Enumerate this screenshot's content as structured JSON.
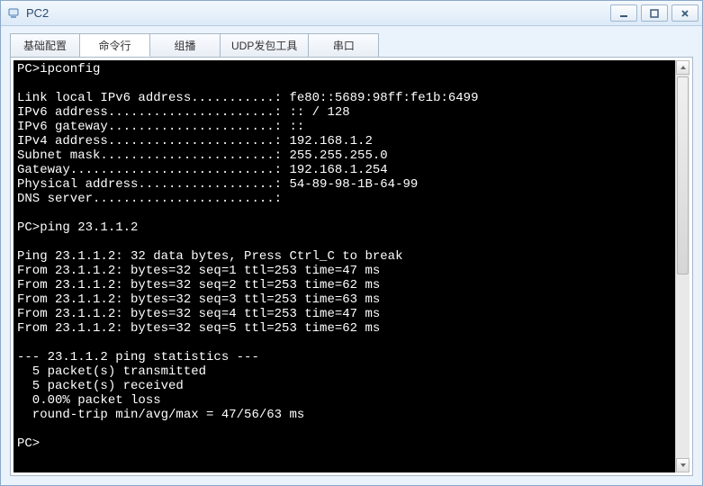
{
  "window": {
    "title": "PC2"
  },
  "tabs": [
    {
      "label": "基础配置"
    },
    {
      "label": "命令行"
    },
    {
      "label": "组播"
    },
    {
      "label": "UDP发包工具"
    },
    {
      "label": "串口"
    }
  ],
  "terminal": {
    "lines": [
      "PC>ipconfig",
      "",
      "Link local IPv6 address...........: fe80::5689:98ff:fe1b:6499",
      "IPv6 address......................: :: / 128",
      "IPv6 gateway......................: ::",
      "IPv4 address......................: 192.168.1.2",
      "Subnet mask.......................: 255.255.255.0",
      "Gateway...........................: 192.168.1.254",
      "Physical address..................: 54-89-98-1B-64-99",
      "DNS server........................:",
      "",
      "PC>ping 23.1.1.2",
      "",
      "Ping 23.1.1.2: 32 data bytes, Press Ctrl_C to break",
      "From 23.1.1.2: bytes=32 seq=1 ttl=253 time=47 ms",
      "From 23.1.1.2: bytes=32 seq=2 ttl=253 time=62 ms",
      "From 23.1.1.2: bytes=32 seq=3 ttl=253 time=63 ms",
      "From 23.1.1.2: bytes=32 seq=4 ttl=253 time=47 ms",
      "From 23.1.1.2: bytes=32 seq=5 ttl=253 time=62 ms",
      "",
      "--- 23.1.1.2 ping statistics ---",
      "  5 packet(s) transmitted",
      "  5 packet(s) received",
      "  0.00% packet loss",
      "  round-trip min/avg/max = 47/56/63 ms",
      "",
      "PC>"
    ]
  }
}
